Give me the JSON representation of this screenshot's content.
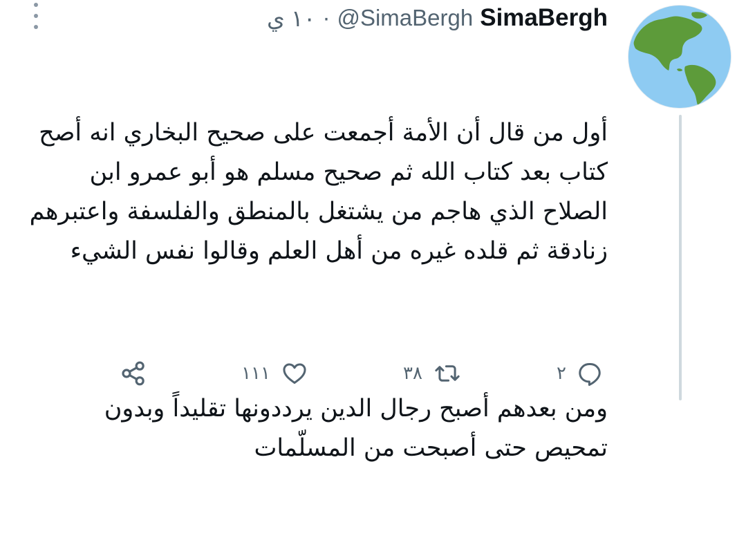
{
  "tweet": {
    "display_name": "SimaBergh",
    "handle": "@SimaBergh",
    "separator": "·",
    "time": "١٠ ي",
    "paragraphs": [
      "أول من قال أن الأمة أجمعت على صحيح البخاري انه أصح كتاب بعد كتاب الله ثم صحيح مسلم هو أبو عمرو ابن الصلاح الذي هاجم من يشتغل بالمنطق والفلسفة واعتبرهم زنادقة ثم قلده غيره من أهل العلم وقالوا نفس الشيء",
      "ومن بعدهم أصبح رجال الدين يرددونها تقليداً وبدون تمحيص حتى أصبحت من المسلّمات"
    ]
  },
  "actions": {
    "reply": {
      "icon": "reply-icon",
      "count": "٢"
    },
    "retweet": {
      "icon": "retweet-icon",
      "count": "٣٨"
    },
    "like": {
      "icon": "heart-icon",
      "count": "١١١"
    },
    "share": {
      "icon": "share-icon"
    }
  },
  "avatar": {
    "icon": "globe-americas-icon"
  },
  "colors": {
    "text": "#0f1419",
    "muted": "#536471",
    "thread_line": "#cfd9de",
    "ocean": "#8ecbf2",
    "land": "#5d9b3a"
  }
}
